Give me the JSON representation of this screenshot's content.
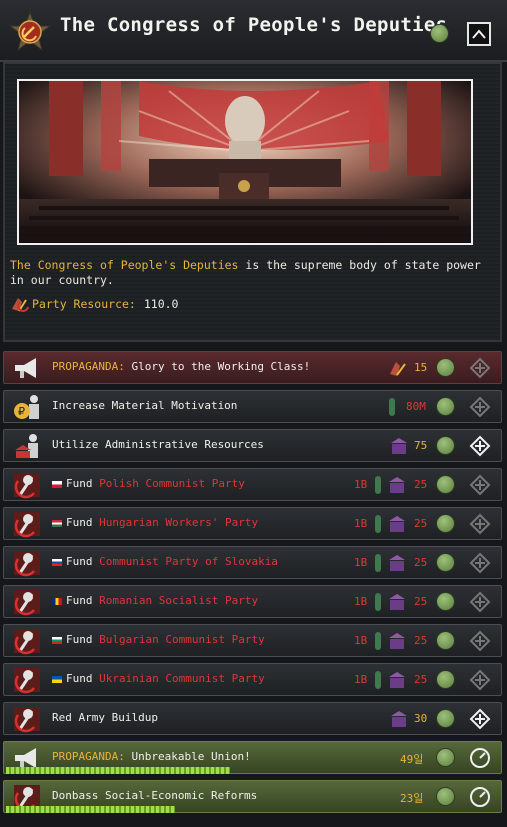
{
  "header": {
    "title": "The Congress of People's Deputies"
  },
  "colors": {
    "accent_gold": "#e6b43a",
    "cost_red": "#d93a34",
    "ready_green": "#7da05a"
  },
  "intro": {
    "highlight": "The Congress of People's Deputies",
    "text": "is the supreme body of state power in our country.",
    "resource_label": "Party Resource:",
    "resource_value": "110.0"
  },
  "decisions": [
    {
      "prefix": "PROPAGANDA:",
      "label": "Glory to the Working Class!",
      "cost": "15",
      "icon": "megaphone-icon",
      "action": "disabled"
    },
    {
      "label": "Increase Material Motivation",
      "cost": "80M",
      "icon": "ruble-worker-icon",
      "action": "disabled"
    },
    {
      "label": "Utilize Administrative Resources",
      "cost": "75",
      "icon": "admin-worker-icon",
      "action": "enabled"
    },
    {
      "pre": "Fund",
      "label": "Polish Communist Party",
      "cost_a": "1B",
      "cost_b": "25",
      "flag": "poland-flag-icon",
      "action": "disabled"
    },
    {
      "pre": "Fund",
      "label": "Hungarian Workers' Party",
      "cost_a": "1B",
      "cost_b": "25",
      "flag": "hungary-flag-icon",
      "action": "disabled"
    },
    {
      "pre": "Fund",
      "label": "Communist Party of Slovakia",
      "cost_a": "1B",
      "cost_b": "25",
      "flag": "slovakia-flag-icon",
      "action": "disabled"
    },
    {
      "pre": "Fund",
      "label": "Romanian Socialist Party",
      "cost_a": "1B",
      "cost_b": "25",
      "flag": "romania-flag-icon",
      "action": "disabled"
    },
    {
      "pre": "Fund",
      "label": "Bulgarian Communist Party",
      "cost_a": "1B",
      "cost_b": "25",
      "flag": "bulgaria-flag-icon",
      "action": "disabled"
    },
    {
      "pre": "Fund",
      "label": "Ukrainian Communist Party",
      "cost_a": "1B",
      "cost_b": "25",
      "flag": "ukraine-flag-icon",
      "action": "disabled"
    },
    {
      "label": "Red Army Buildup",
      "cost": "30",
      "action": "enabled"
    },
    {
      "prefix": "PROPAGANDA:",
      "label": "Unbreakable Union!",
      "days": "49일",
      "progress": 0.45
    },
    {
      "label": "Donbass Social-Economic Reforms",
      "days": "23일",
      "progress": 0.34
    }
  ]
}
